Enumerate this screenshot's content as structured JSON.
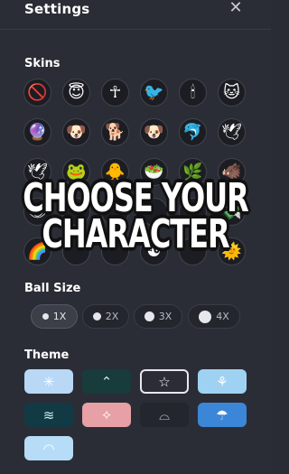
{
  "header": {
    "title": "Settings",
    "close_icon": "close-icon"
  },
  "skins": {
    "title": "Skins",
    "items": [
      {
        "name": "none",
        "glyph": "🚫"
      },
      {
        "name": "smiley-halo",
        "glyph": "😇"
      },
      {
        "name": "ankh",
        "glyph": "☥"
      },
      {
        "name": "bird",
        "glyph": "🐦"
      },
      {
        "name": "candle",
        "glyph": "🕯"
      },
      {
        "name": "cat",
        "glyph": "🐱"
      },
      {
        "name": "crystal-ball",
        "glyph": "🔮"
      },
      {
        "name": "dog",
        "glyph": "🐶"
      },
      {
        "name": "puppy",
        "glyph": "🐕"
      },
      {
        "name": "pug",
        "glyph": "🐶"
      },
      {
        "name": "dolphin",
        "glyph": "🐬"
      },
      {
        "name": "dove-olive",
        "glyph": "🕊"
      },
      {
        "name": "dove",
        "glyph": "🕊"
      },
      {
        "name": "frog",
        "glyph": "🐸"
      },
      {
        "name": "chick",
        "glyph": "🐥"
      },
      {
        "name": "salad",
        "glyph": "🥗"
      },
      {
        "name": "plant",
        "glyph": "🌿"
      },
      {
        "name": "boar",
        "glyph": "🐗"
      },
      {
        "name": "eye",
        "glyph": "👁"
      },
      {
        "name": "hidden-1",
        "glyph": ""
      },
      {
        "name": "hidden-2",
        "glyph": ""
      },
      {
        "name": "hidden-3",
        "glyph": ""
      },
      {
        "name": "hidden-4",
        "glyph": ""
      },
      {
        "name": "money",
        "glyph": "💸"
      },
      {
        "name": "rainbow",
        "glyph": "🌈"
      },
      {
        "name": "hidden-5",
        "glyph": ""
      },
      {
        "name": "hidden-6",
        "glyph": ""
      },
      {
        "name": "yin-yang",
        "glyph": "☯"
      },
      {
        "name": "hidden-7",
        "glyph": ""
      },
      {
        "name": "sun",
        "glyph": "🌞"
      }
    ]
  },
  "overlay": {
    "line1": "CHOOSE YOUR",
    "line2": "CHARACTER"
  },
  "ball_size": {
    "title": "Ball Size",
    "options": [
      {
        "label": "1X",
        "active": true
      },
      {
        "label": "2X",
        "active": false
      },
      {
        "label": "3X",
        "active": false
      },
      {
        "label": "4X",
        "active": false
      }
    ]
  },
  "theme": {
    "title": "Theme",
    "options": [
      {
        "name": "snowflake",
        "glyph": "✳",
        "bg": "#b9d8f6",
        "fg": "#ffffff",
        "selected": false
      },
      {
        "name": "circle-up",
        "glyph": "⌃",
        "bg": "#183b3c",
        "fg": "#cfe9e9",
        "selected": false
      },
      {
        "name": "star",
        "glyph": "☆",
        "bg": "#2b2d36",
        "fg": "#ffffff",
        "selected": true
      },
      {
        "name": "flower",
        "glyph": "⚘",
        "bg": "#9fd2f2",
        "fg": "#ffffff",
        "selected": false
      },
      {
        "name": "waves",
        "glyph": "≋",
        "bg": "#123a44",
        "fg": "#cfe8ee",
        "selected": false
      },
      {
        "name": "compass",
        "glyph": "✧",
        "bg": "#e6a0a6",
        "fg": "#ffffff",
        "selected": false
      },
      {
        "name": "sunrise",
        "glyph": "⌓",
        "bg": "#24262d",
        "fg": "#c9cad0",
        "selected": false
      },
      {
        "name": "rain-cloud",
        "glyph": "☂",
        "bg": "#3b86d7",
        "fg": "#ffffff",
        "selected": false
      },
      {
        "name": "dome",
        "glyph": "◠",
        "bg": "#b6dcf7",
        "fg": "#ffffff",
        "selected": false
      }
    ]
  }
}
